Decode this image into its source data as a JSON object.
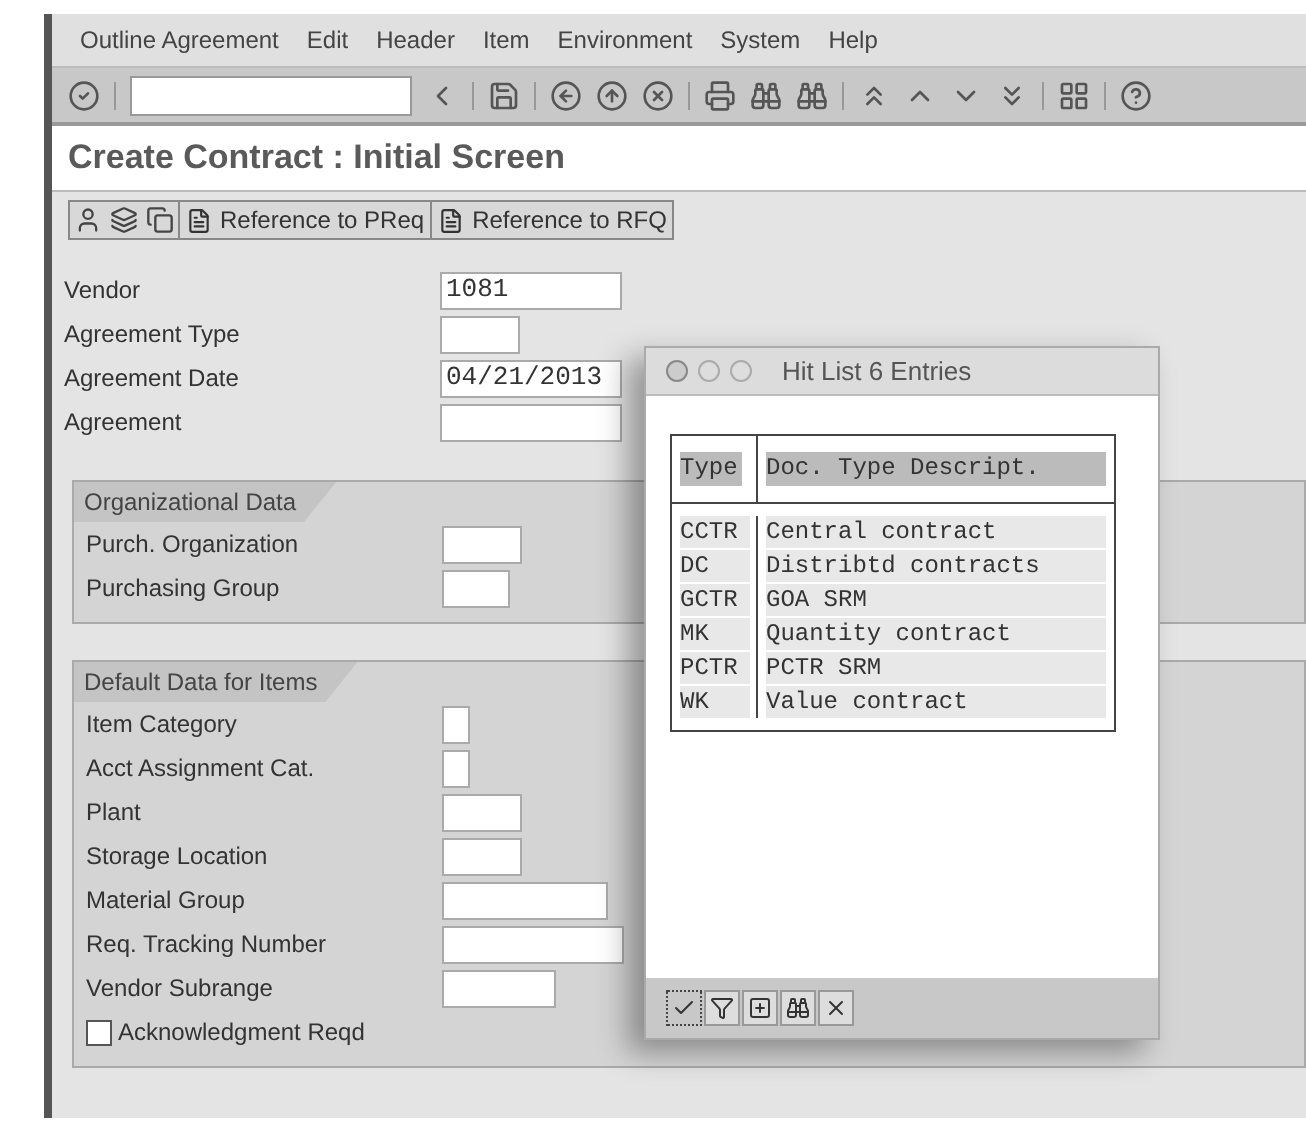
{
  "menu": [
    "Outline Agreement",
    "Edit",
    "Header",
    "Item",
    "Environment",
    "System",
    "Help"
  ],
  "title": "Create Contract : Initial Screen",
  "app_toolbar": {
    "buttons": [
      "Reference to PReq",
      "Reference to RFQ"
    ]
  },
  "header_fields": [
    {
      "label": "Vendor",
      "value": "1081"
    },
    {
      "label": "Agreement Type"
    },
    {
      "label": "Agreement Date",
      "value": "04/21/2013"
    },
    {
      "label": "Agreement"
    }
  ],
  "groups": [
    {
      "title": "Organizational Data",
      "fields": [
        {
          "kind": "field",
          "label": "Purch. Organization"
        },
        {
          "kind": "field",
          "label": "Purchasing Group"
        }
      ]
    },
    {
      "title": "Default Data for Items",
      "fields": [
        {
          "kind": "field",
          "label": "Item Category"
        },
        {
          "kind": "field",
          "label": "Acct Assignment Cat."
        },
        {
          "kind": "field",
          "label": "Plant"
        },
        {
          "kind": "field",
          "label": "Storage Location"
        },
        {
          "kind": "field",
          "label": "Material Group"
        },
        {
          "kind": "field",
          "label": "Req. Tracking Number"
        },
        {
          "kind": "field",
          "label": "Vendor Subrange"
        },
        {
          "kind": "checkbox",
          "label": "Acknowledgment Reqd",
          "checked": false
        }
      ]
    }
  ],
  "hit_list": {
    "title": "Hit List 6 Entries",
    "columns": [
      "Type",
      "Doc. Type Descript."
    ],
    "rows": [
      [
        "CCTR",
        "Central contract"
      ],
      [
        "DC",
        "Distribtd contracts"
      ],
      [
        "GCTR",
        "GOA SRM"
      ],
      [
        "MK",
        "Quantity contract"
      ],
      [
        "PCTR",
        "PCTR SRM"
      ],
      [
        "WK",
        "Value contract"
      ]
    ]
  }
}
